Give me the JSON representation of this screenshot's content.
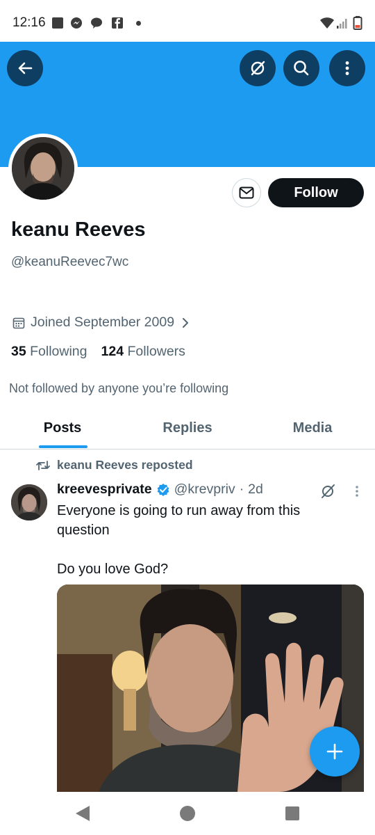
{
  "status_bar": {
    "time": "12:16",
    "icons": [
      "square-notification-icon",
      "messenger-icon",
      "chat-bubble-icon",
      "facebook-icon",
      "dot-icon",
      "wifi-icon",
      "signal-icon",
      "battery-icon"
    ]
  },
  "header": {
    "banner_color": "#1d9bf0",
    "buttons": [
      "back-arrow-icon",
      "grok-icon",
      "search-icon",
      "more-vertical-icon"
    ]
  },
  "profile": {
    "name": "keanu Reeves",
    "handle": "@keanuReevec7wc",
    "joined": "Joined September 2009",
    "following_count": "35",
    "following_label": "Following",
    "followers_count": "124",
    "followers_label": "Followers",
    "not_followed_note": "Not followed by anyone you’re following",
    "follow_label": "Follow"
  },
  "tabs": [
    {
      "label": "Posts",
      "active": true
    },
    {
      "label": "Replies",
      "active": false
    },
    {
      "label": "Media",
      "active": false
    }
  ],
  "post": {
    "repost_note": "keanu Reeves reposted",
    "author": "kreevesprivate",
    "verified": true,
    "handle": "@krevpriv",
    "separator": "·",
    "time": "2d",
    "text": "Everyone is going to run away from this\nquestion\n\nDo you love God?"
  },
  "colors": {
    "accent": "#1d9bf0",
    "header_button": "#0f3e63",
    "text_primary": "#0f1419",
    "text_secondary": "#536471"
  }
}
